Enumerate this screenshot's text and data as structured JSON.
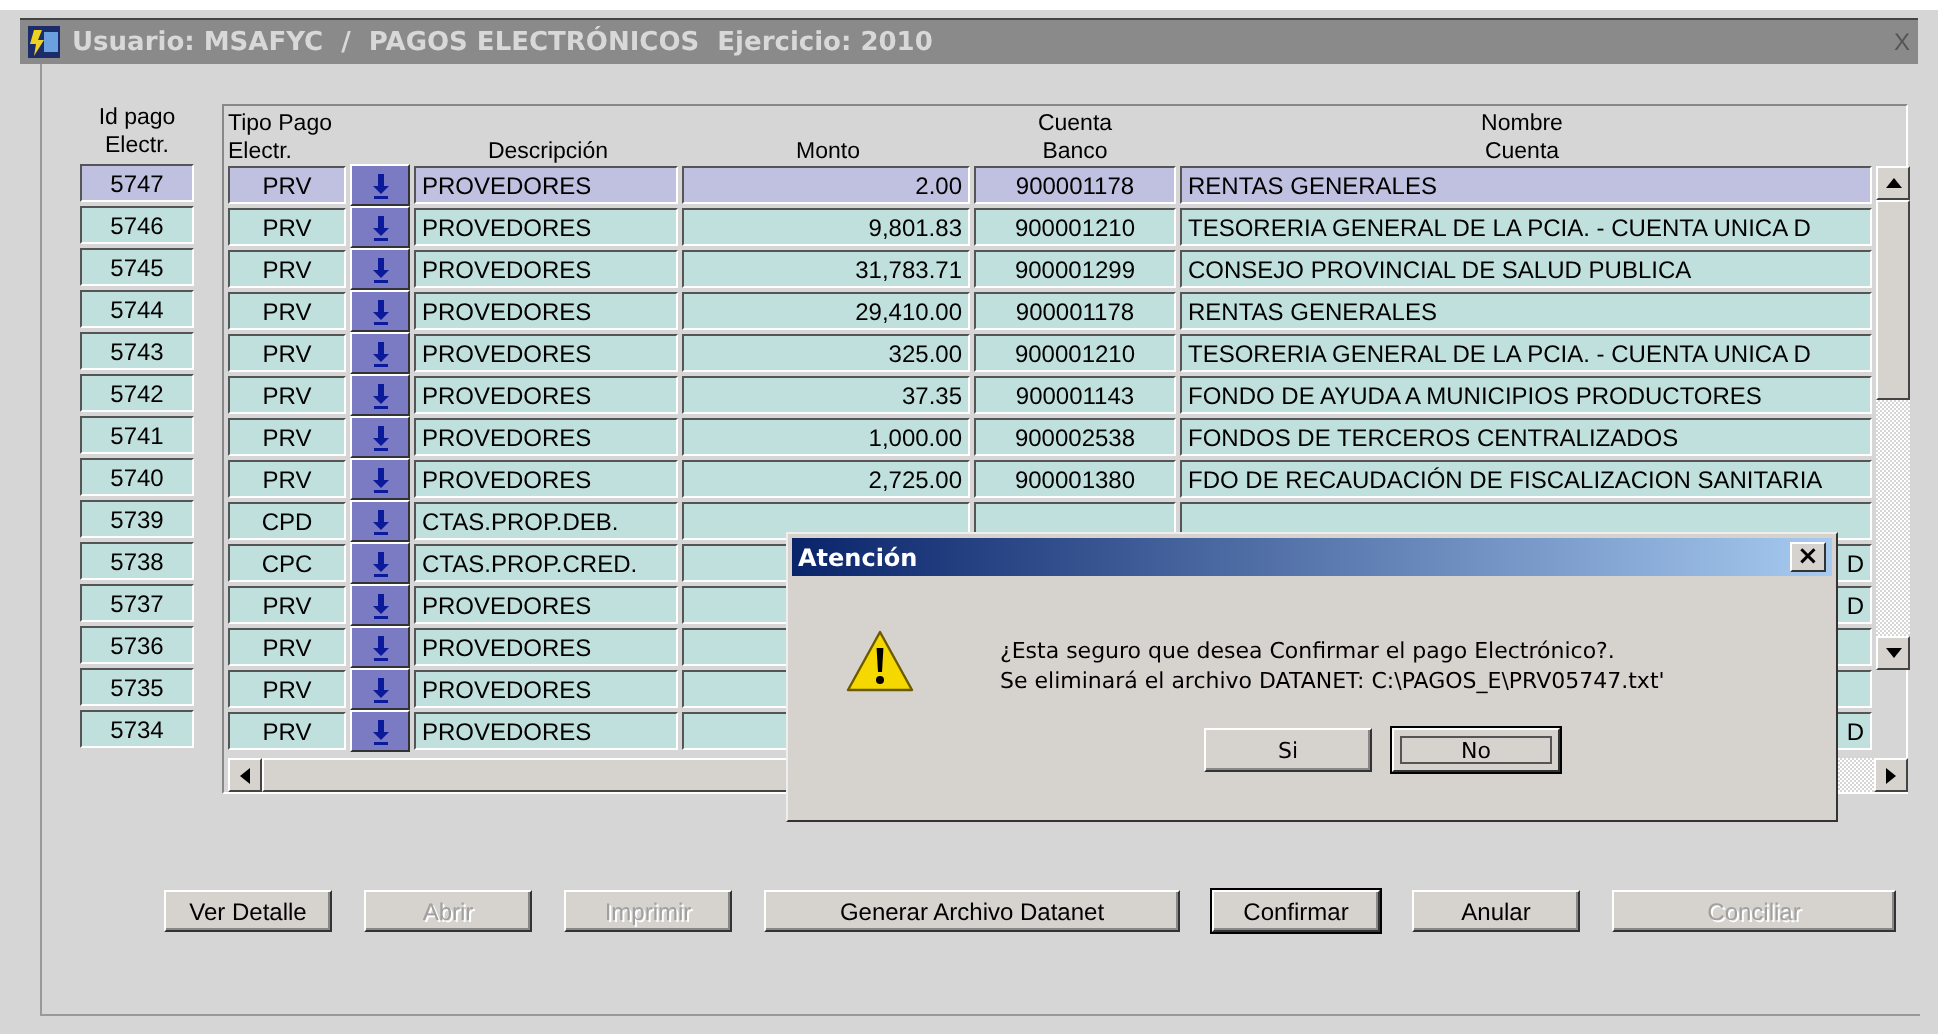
{
  "window": {
    "title": "Usuario: MSAFYC  /  PAGOS ELECTRÓNICOS  Ejercicio: 2010",
    "close": "X"
  },
  "columns": {
    "id": "Id pago\nElectr.",
    "tipo": "Tipo Pago\nElectr.",
    "descripcion": "Descripción",
    "monto": "Monto",
    "cuenta": "Cuenta\nBanco",
    "nombre": "Nombre\nCuenta"
  },
  "rows": [
    {
      "id": "5747",
      "tipo": "PRV",
      "descripcion": "PROVEDORES",
      "monto": "2.00",
      "cuenta": "900001178",
      "nombre": "RENTAS GENERALES",
      "selected": true
    },
    {
      "id": "5746",
      "tipo": "PRV",
      "descripcion": "PROVEDORES",
      "monto": "9,801.83",
      "cuenta": "900001210",
      "nombre": "TESORERIA GENERAL DE LA PCIA. - CUENTA UNICA D",
      "selected": false
    },
    {
      "id": "5745",
      "tipo": "PRV",
      "descripcion": "PROVEDORES",
      "monto": "31,783.71",
      "cuenta": "900001299",
      "nombre": "CONSEJO PROVINCIAL DE SALUD PUBLICA",
      "selected": false
    },
    {
      "id": "5744",
      "tipo": "PRV",
      "descripcion": "PROVEDORES",
      "monto": "29,410.00",
      "cuenta": "900001178",
      "nombre": "RENTAS GENERALES",
      "selected": false
    },
    {
      "id": "5743",
      "tipo": "PRV",
      "descripcion": "PROVEDORES",
      "monto": "325.00",
      "cuenta": "900001210",
      "nombre": "TESORERIA GENERAL DE LA PCIA. - CUENTA UNICA D",
      "selected": false
    },
    {
      "id": "5742",
      "tipo": "PRV",
      "descripcion": "PROVEDORES",
      "monto": "37.35",
      "cuenta": "900001143",
      "nombre": "FONDO DE AYUDA A MUNICIPIOS PRODUCTORES",
      "selected": false
    },
    {
      "id": "5741",
      "tipo": "PRV",
      "descripcion": "PROVEDORES",
      "monto": "1,000.00",
      "cuenta": "900002538",
      "nombre": "FONDOS DE TERCEROS CENTRALIZADOS",
      "selected": false
    },
    {
      "id": "5740",
      "tipo": "PRV",
      "descripcion": "PROVEDORES",
      "monto": "2,725.00",
      "cuenta": "900001380",
      "nombre": "FDO DE RECAUDACIÓN DE FISCALIZACION SANITARIA",
      "selected": false
    },
    {
      "id": "5739",
      "tipo": "CPD",
      "descripcion": "CTAS.PROP.DEB.",
      "selected": false
    },
    {
      "id": "5738",
      "tipo": "CPC",
      "descripcion": "CTAS.PROP.CRED.",
      "nombre_tail": "D",
      "selected": false
    },
    {
      "id": "5737",
      "tipo": "PRV",
      "descripcion": "PROVEDORES",
      "nombre_tail": "D",
      "selected": false
    },
    {
      "id": "5736",
      "tipo": "PRV",
      "descripcion": "PROVEDORES",
      "selected": false
    },
    {
      "id": "5735",
      "tipo": "PRV",
      "descripcion": "PROVEDORES",
      "selected": false
    },
    {
      "id": "5734",
      "tipo": "PRV",
      "descripcion": "PROVEDORES",
      "nombre_tail": "D",
      "selected": false
    }
  ],
  "buttons": [
    {
      "label": "Ver Detalle",
      "disabled": false,
      "default": false
    },
    {
      "label": "Abrir",
      "disabled": true,
      "default": false
    },
    {
      "label": "Imprimir",
      "disabled": true,
      "default": false
    },
    {
      "label": "Generar Archivo Datanet",
      "disabled": false,
      "default": false
    },
    {
      "label": "Confirmar",
      "disabled": false,
      "default": true
    },
    {
      "label": "Anular",
      "disabled": false,
      "default": false
    },
    {
      "label": "Conciliar",
      "disabled": true,
      "default": false
    }
  ],
  "dialog": {
    "title": "Atención",
    "close": "×",
    "message": "¿Esta seguro que desea Confirmar el pago Electrónico?.\nSe eliminará el archivo DATANET: C:\\PAGOS_E\\PRV05747.txt'",
    "buttons": [
      {
        "label": "Si",
        "focused": false
      },
      {
        "label": "No",
        "focused": true
      }
    ]
  }
}
